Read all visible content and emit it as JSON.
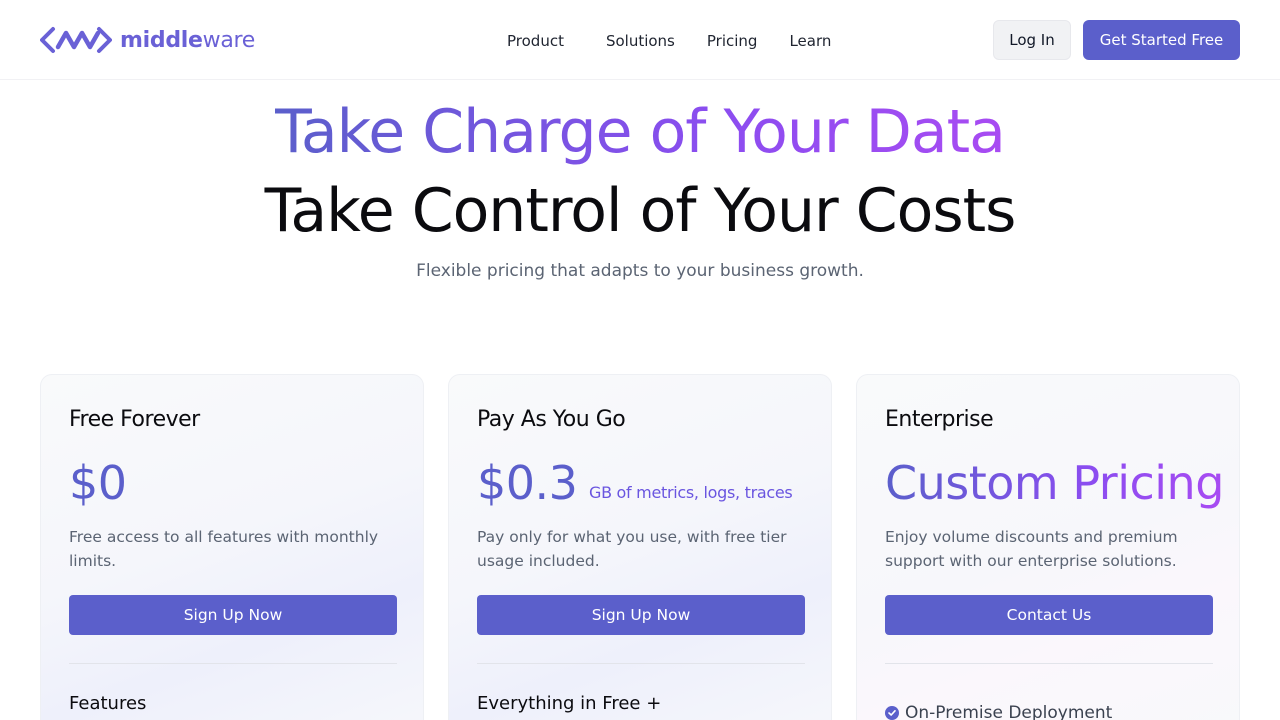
{
  "header": {
    "logo_text_bold": "middle",
    "logo_text_rest": "ware",
    "nav": [
      "Product",
      "Solutions",
      "Pricing",
      "Learn"
    ],
    "login_label": "Log In",
    "get_started_label": "Get Started Free"
  },
  "hero": {
    "title": "Take Charge of Your Data",
    "subtitle": "Take Control of Your Costs",
    "description": "Flexible pricing that adapts to your business growth."
  },
  "plans": [
    {
      "name": "Free Forever",
      "price": "$0",
      "description": "Free access to all features with monthly limits.",
      "button": "Sign Up Now",
      "section": "Features"
    },
    {
      "name": "Pay As You Go",
      "price": "$0.3",
      "unit": "GB of metrics, logs, traces",
      "description": "Pay only for what you use, with free tier usage included.",
      "button": "Sign Up Now",
      "section": "Everything in Free +"
    },
    {
      "name": "Enterprise",
      "price": "Custom Pricing",
      "description": "Enjoy volume discounts and premium support with our enterprise solutions.",
      "button": "Contact Us",
      "feature": "On-Premise Deployment"
    }
  ],
  "colors": {
    "brand": "#5B5FCB",
    "gradient_end": "#A84BF2"
  },
  "icons": [
    "middleware-logo-icon",
    "check-circle-icon"
  ]
}
